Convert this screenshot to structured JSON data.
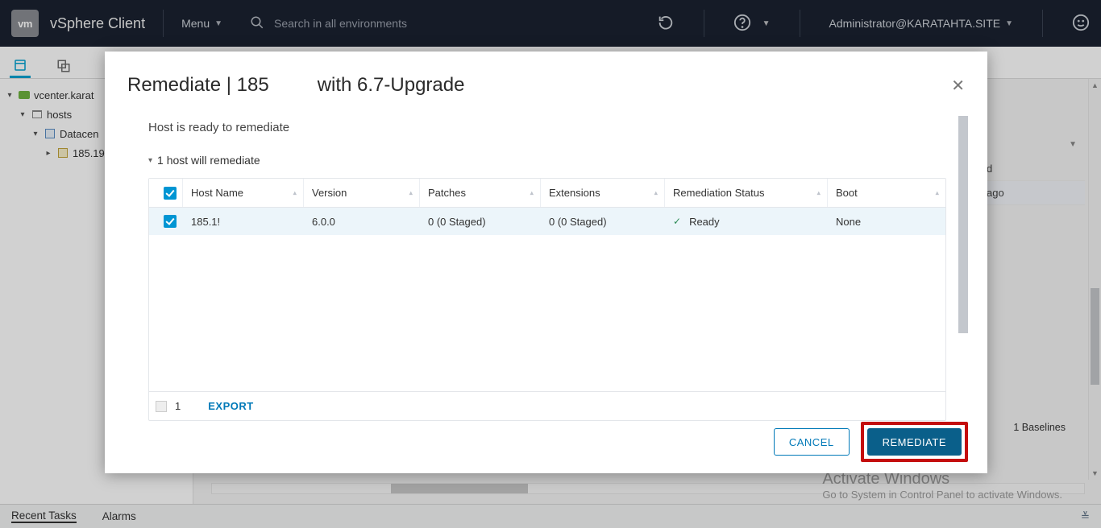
{
  "topbar": {
    "logo": "vm",
    "app_title": "vSphere Client",
    "menu_label": "Menu",
    "search_placeholder": "Search in all environments",
    "user": "Administrator@KARATAHTA.SITE"
  },
  "tree": {
    "items": [
      {
        "label": "vcenter.karat",
        "icon": "vcenter",
        "indent": 0
      },
      {
        "label": "hosts",
        "icon": "folder",
        "indent": 1
      },
      {
        "label": "Datacen",
        "icon": "datacenter",
        "indent": 2
      },
      {
        "label": "185.19",
        "icon": "host",
        "indent": 3
      }
    ]
  },
  "bg": {
    "row1": "d",
    "row2": "ago",
    "baselines": "1 Baselines"
  },
  "modal": {
    "title_left": "Remediate | 185",
    "title_right": "with 6.7-Upgrade",
    "status_line": "Host is ready to remediate",
    "expand_line": "1 host will remediate",
    "columns": {
      "host": "Host Name",
      "version": "Version",
      "patches": "Patches",
      "extensions": "Extensions",
      "status": "Remediation Status",
      "boot": "Boot"
    },
    "row": {
      "host": "185.1!",
      "version": "6.0.0",
      "patches": "0 (0 Staged)",
      "extensions": "0 (0 Staged)",
      "status": "Ready",
      "boot": "None"
    },
    "count": "1",
    "export": "EXPORT",
    "cancel": "CANCEL",
    "remediate": "REMEDIATE"
  },
  "watermark": {
    "line1": "Activate Windows",
    "line2": "Go to System in Control Panel to activate Windows."
  },
  "footer": {
    "recent": "Recent Tasks",
    "alarms": "Alarms"
  }
}
